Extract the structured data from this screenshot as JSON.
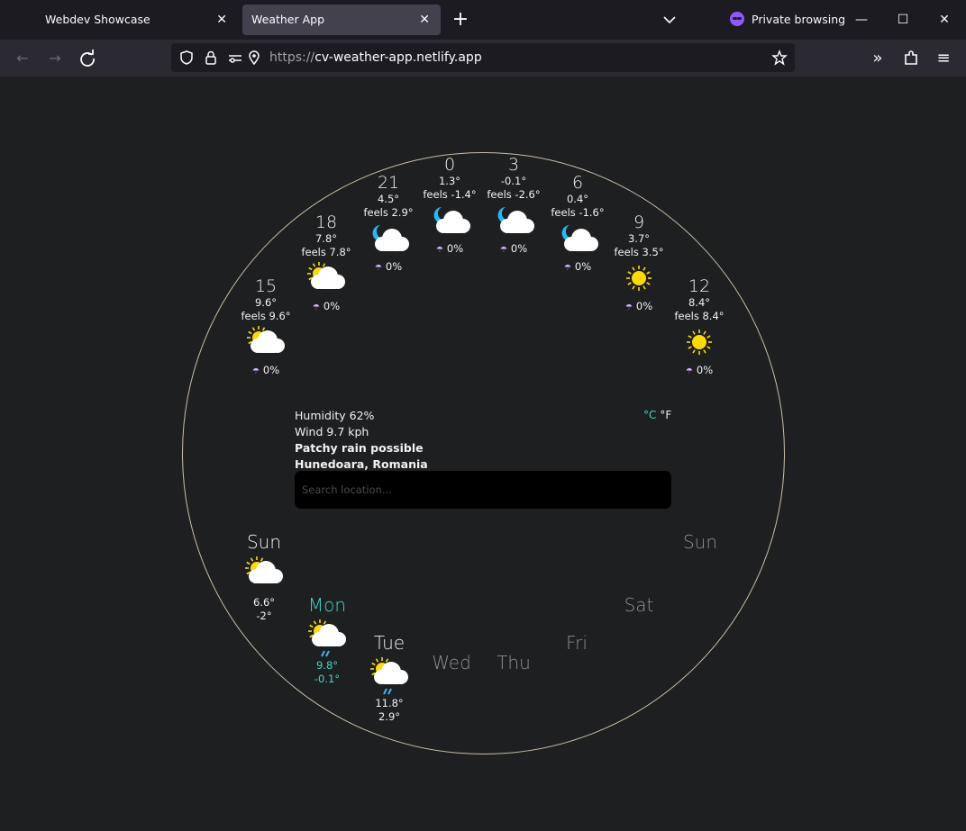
{
  "browser": {
    "tabs": [
      {
        "title": "Webdev Showcase"
      },
      {
        "title": "Weather App"
      }
    ],
    "private_label": "Private browsing",
    "url_proto": "https://",
    "url_host": "cv-weather-app.netlify.app"
  },
  "hourly": [
    {
      "hour": "15",
      "temp": "9.6°",
      "feels": "feels 9.6°",
      "icon": "partly-cloudy-day-icon",
      "rain": "0%"
    },
    {
      "hour": "18",
      "temp": "7.8°",
      "feels": "feels 7.8°",
      "icon": "partly-cloudy-day-icon",
      "rain": "0%"
    },
    {
      "hour": "21",
      "temp": "4.5°",
      "feels": "feels 2.9°",
      "icon": "partly-cloudy-night-icon",
      "rain": "0%"
    },
    {
      "hour": "0",
      "temp": "1.3°",
      "feels": "feels -1.4°",
      "icon": "partly-cloudy-night-icon",
      "rain": "0%"
    },
    {
      "hour": "3",
      "temp": "-0.1°",
      "feels": "feels -2.6°",
      "icon": "partly-cloudy-night-icon",
      "rain": "0%"
    },
    {
      "hour": "6",
      "temp": "0.4°",
      "feels": "feels -1.6°",
      "icon": "partly-cloudy-night-icon",
      "rain": "0%"
    },
    {
      "hour": "9",
      "temp": "3.7°",
      "feels": "feels 3.5°",
      "icon": "sun-icon",
      "rain": "0%"
    },
    {
      "hour": "12",
      "temp": "8.4°",
      "feels": "feels 8.4°",
      "icon": "sun-icon",
      "rain": "0%"
    }
  ],
  "current": {
    "humidity": "Humidity 62%",
    "wind": "Wind 9.7 kph",
    "condition": "Patchy rain possible",
    "location": "Hunedoara, Romania",
    "unit_c": "°C",
    "unit_f": "°F"
  },
  "search": {
    "placeholder": "Search location..."
  },
  "colors": {
    "accent": "#44d7c4",
    "ring": "#c9bfa6",
    "sun": "#ffd80a",
    "moon": "#28b6f6",
    "background": "#1e1f21"
  },
  "daily": [
    {
      "day": "Sun",
      "icon": "partly-cloudy-day-icon",
      "max": "6.6°",
      "min": "-2°",
      "state": "past"
    },
    {
      "day": "Mon",
      "icon": "partly-cloudy-rain-icon",
      "max": "9.8°",
      "min": "-0.1°",
      "state": "selected"
    },
    {
      "day": "Tue",
      "icon": "partly-cloudy-rain-icon",
      "max": "11.8°",
      "min": "2.9°",
      "state": "normal"
    },
    {
      "day": "Wed",
      "state": "dim"
    },
    {
      "day": "Thu",
      "state": "dim"
    },
    {
      "day": "Fri",
      "state": "dim"
    },
    {
      "day": "Sat",
      "state": "dim"
    },
    {
      "day": "Sun",
      "state": "dim"
    }
  ]
}
